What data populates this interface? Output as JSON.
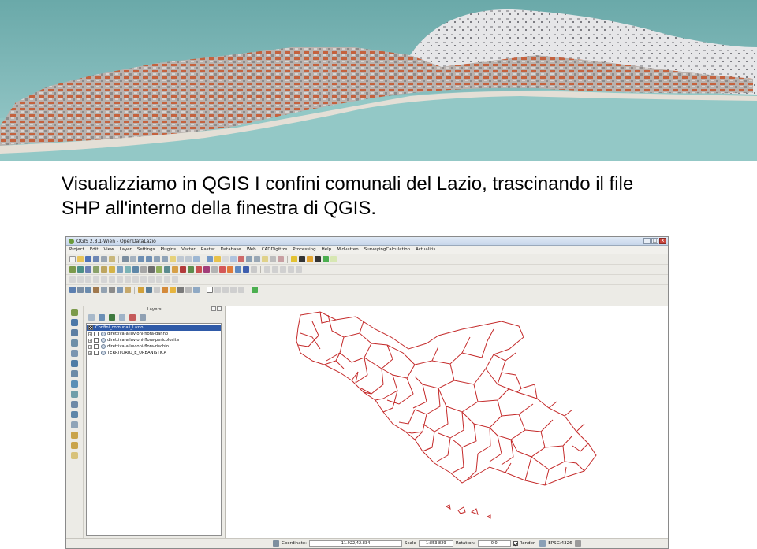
{
  "slide": {
    "caption_line1": "Visualizziamo in QGIS I confini comunali del Lazio, trascinando il file",
    "caption_line2": "SHP all'interno della finestra di QGIS."
  },
  "window": {
    "title": "QGIS 2.8.1-Wien - OpenDataLazio",
    "controls": [
      "_",
      "□",
      "x"
    ]
  },
  "menu": [
    "Project",
    "Edit",
    "View",
    "Layer",
    "Settings",
    "Plugins",
    "Vector",
    "Raster",
    "Database",
    "Web",
    "CADDigitize",
    "Processing",
    "Help",
    "Midvatten",
    "SurveyingCalculation",
    "Actualitis"
  ],
  "layers_panel": {
    "title": "Layers",
    "layers": [
      {
        "name": "Confini_comunali_Lazio",
        "checked": true,
        "selected": true
      },
      {
        "name": "direttiva-alluvioni-flora-danno",
        "checked": false,
        "selected": false
      },
      {
        "name": "direttiva-alluvioni-flora-pericolosita",
        "checked": false,
        "selected": false
      },
      {
        "name": "direttiva-alluvioni-flora-rischio",
        "checked": false,
        "selected": false
      },
      {
        "name": "TERRITORIO_E_URBANISTICA",
        "checked": false,
        "selected": false
      }
    ]
  },
  "status": {
    "coordinate_label": "Coordinate:",
    "coordinate_value": "11.922,42.834",
    "scale_label": "Scale",
    "scale_value": "1:853.829",
    "rotation_label": "Rotation:",
    "rotation_value": "0.0",
    "render_label": "Render",
    "crs_label": "EPSG:4326"
  },
  "colors": {
    "boundary_stroke": "#c42a2a",
    "selected_layer": "#2f5aa8",
    "window_bg": "#ecebe6",
    "sea": "#8fc4c4"
  }
}
